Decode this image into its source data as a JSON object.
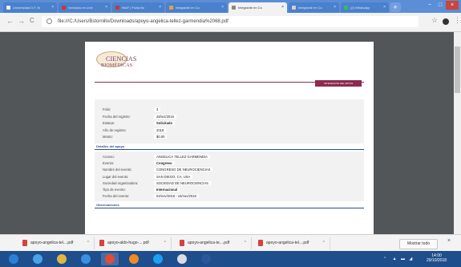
{
  "browser": {
    "tabs": [
      {
        "label": "Universidad D.F. M",
        "icon_color": "#f0f0f0"
      },
      {
        "label": "Servicios en Líne",
        "icon_color": "#d03434"
      },
      {
        "label": "INAF | Ficha Bo",
        "icon_color": "#d03434"
      },
      {
        "label": "Integrante en Co",
        "icon_color": "#e8a23a"
      },
      {
        "label": "Integrante en Co",
        "icon_color": "#888888",
        "active": true
      },
      {
        "label": "Integrante en Co",
        "icon_color": "#d0d0d0"
      },
      {
        "label": "(2) WhatsApp",
        "icon_color": "#2fbf5b"
      }
    ],
    "new_tab": "+",
    "window_controls": [
      "−",
      "□",
      "×"
    ],
    "nav": {
      "back": "←",
      "forward": "→",
      "reload": "C"
    },
    "url": "file:///C:/Users/Bstornillo/Downloads/apoyo-angelica-tellez-garmendia%2068.pdf",
    "star_icon": "☆",
    "menu_icon": "⋮"
  },
  "document": {
    "logo": {
      "line1": "CIENCIAS",
      "line2": "BIOMÉDICAS"
    },
    "header_badge": "INTEGRANTE DEL MITOS",
    "fields": [
      {
        "label": "Folio:",
        "value": "3"
      },
      {
        "label": "Fecha del registro:",
        "value": "28/oct/2018"
      },
      {
        "label": "Estatus:",
        "value": "Solicitado"
      },
      {
        "label": "Año de registro:",
        "value": "2018"
      },
      {
        "label": "Monto:",
        "value": "$0.00"
      }
    ],
    "support_section_title": "Detalles del apoyo",
    "support_fields": [
      {
        "label": "Acceso:",
        "value": "ANGELICA TELLEZ GARMENDIA"
      },
      {
        "label": "Evento:",
        "value": "Congreso"
      },
      {
        "label": "Nombre del evento:",
        "value": "CONGRESO DE NEUROCIENCIAS"
      },
      {
        "label": "Lugar del evento:",
        "value": "SAN DIEGO, CA, USA"
      },
      {
        "label": "Sociedad organizadora:",
        "value": "SOCIEDAD DE NEUROCIENCIAS"
      },
      {
        "label": "Tipo de evento:",
        "value": "Internacional"
      },
      {
        "label": "Fecha del evento:",
        "value": "04/nov/2018 - 15/nov/2018"
      }
    ],
    "observations_title": "Observaciones"
  },
  "downloads": {
    "items": [
      {
        "name": "apoyo-angelica-tel....pdf"
      },
      {
        "name": "apoyo-aldo-hugo-....pdf"
      },
      {
        "name": "apoyo-angelica-te....pdf"
      },
      {
        "name": "apoyo-angelica-tel....pdf"
      }
    ],
    "show_all": "Mostrar todo",
    "close": "×"
  },
  "taskbar": {
    "apps": [
      {
        "name": "start",
        "color": "#2c7fd6"
      },
      {
        "name": "media",
        "color": "#4aa3e8"
      },
      {
        "name": "explorer",
        "color": "#e2b640"
      },
      {
        "name": "ie",
        "color": "#3a8fe0"
      },
      {
        "name": "chrome",
        "color": "#e04b3a"
      },
      {
        "name": "firefox",
        "color": "#f08a24"
      },
      {
        "name": "skype",
        "color": "#1da1f2"
      },
      {
        "name": "files",
        "color": "#d8dde8"
      },
      {
        "name": "word",
        "color": "#2b579a"
      }
    ],
    "clock_time": "14:00",
    "clock_date": "29/10/2018"
  }
}
